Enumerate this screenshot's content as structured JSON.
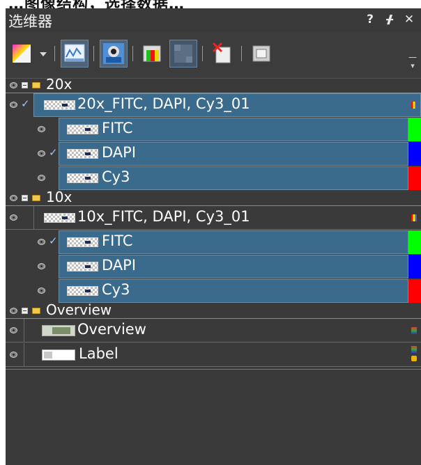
{
  "window": {
    "title": "选维器",
    "buttons": {
      "help": "?",
      "pin": "ᚋ",
      "close": "✕"
    }
  },
  "top_strip_text": "…图像结构，选择数据…",
  "toolbar": {
    "tools": [
      {
        "icon": "color-gradient-icon",
        "state": "normal"
      },
      {
        "icon": "dropdown-arrow-icon",
        "state": "normal"
      },
      {
        "icon": "histogram-icon",
        "state": "active"
      },
      {
        "icon": "view-mode-icon",
        "state": "active"
      },
      {
        "icon": "channels-icon",
        "state": "normal"
      },
      {
        "icon": "grid-icon",
        "state": "active"
      },
      {
        "icon": "delete-image-icon",
        "state": "normal"
      },
      {
        "icon": "frame-icon",
        "state": "normal"
      }
    ]
  },
  "tree": {
    "groups": [
      {
        "name": "20x",
        "image": {
          "name": "20x_FITC, DAPI, Cy3_01",
          "checked": true,
          "selected": true
        },
        "channels": [
          {
            "name": "FITC",
            "checked": false,
            "color": "#00ff00"
          },
          {
            "name": "DAPI",
            "checked": true,
            "color": "#0000ff"
          },
          {
            "name": "Cy3",
            "checked": false,
            "color": "#ff0000"
          }
        ]
      },
      {
        "name": "10x",
        "image": {
          "name": "10x_FITC, DAPI, Cy3_01",
          "checked": false,
          "selected": false
        },
        "channels": [
          {
            "name": "FITC",
            "checked": true,
            "color": "#00ff00"
          },
          {
            "name": "DAPI",
            "checked": false,
            "color": "#0000ff"
          },
          {
            "name": "Cy3",
            "checked": false,
            "color": "#ff0000"
          }
        ]
      },
      {
        "name": "Overview",
        "items": [
          {
            "name": "Overview"
          },
          {
            "name": "Label"
          }
        ]
      }
    ]
  }
}
